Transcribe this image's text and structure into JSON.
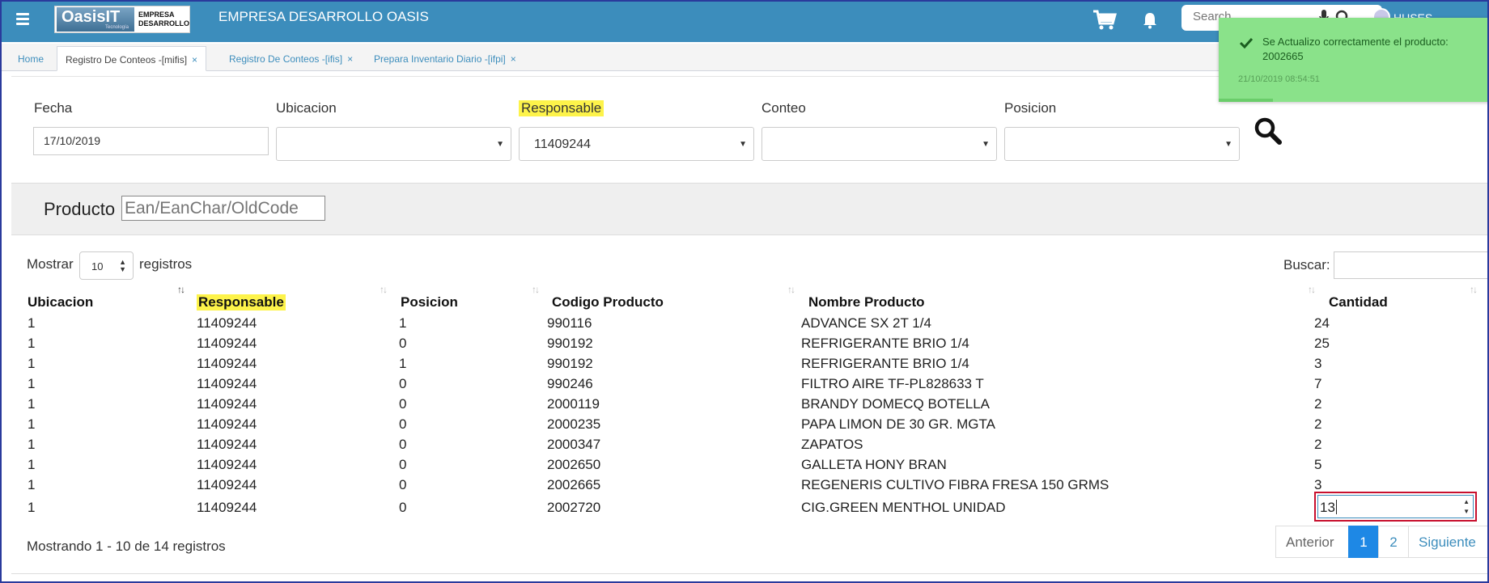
{
  "app": {
    "title": "EMPRESA DESARROLLO OASIS",
    "logo_brand": "OasisIT",
    "logo_sub": "Tecnología",
    "logo_text_1": "EMPRESA",
    "logo_text_2": "DESARROLLO",
    "search_placeholder": "Search",
    "user_name": "HUSES",
    "accent_color": "#3c8dbc"
  },
  "tabs": [
    {
      "label": "Home",
      "closable": false,
      "active": false
    },
    {
      "label": "Registro De Conteos -[mifis]",
      "closable": true,
      "active": true
    },
    {
      "label": "Registro De Conteos -[ifis]",
      "closable": true,
      "active": false
    },
    {
      "label": "Prepara Inventario Diario -[ifpi]",
      "closable": true,
      "active": false
    }
  ],
  "tab_close_glyph": "×",
  "filters": {
    "fecha_label": "Fecha",
    "fecha_value": "17/10/2019",
    "ubicacion_label": "Ubicacion",
    "ubicacion_value": "",
    "responsable_label": "Responsable",
    "responsable_value": "11409244",
    "conteo_label": "Conteo",
    "conteo_value": "",
    "posicion_label": "Posicion",
    "posicion_value": ""
  },
  "product": {
    "label": "Producto",
    "placeholder": "Ean/EanChar/OldCode"
  },
  "table": {
    "show_label": "Mostrar",
    "page_length": "10",
    "records_label": "registros",
    "search_label": "Buscar:",
    "columns": [
      "Ubicacion",
      "Responsable",
      "Posicion",
      "Codigo Producto",
      "Nombre Producto",
      "Cantidad"
    ],
    "rows": [
      {
        "ubicacion": "1",
        "responsable": "11409244",
        "posicion": "1",
        "codigo": "990116",
        "nombre": "ADVANCE SX 2T 1/4",
        "cantidad": "24"
      },
      {
        "ubicacion": "1",
        "responsable": "11409244",
        "posicion": "0",
        "codigo": "990192",
        "nombre": "REFRIGERANTE BRIO 1/4",
        "cantidad": "25"
      },
      {
        "ubicacion": "1",
        "responsable": "11409244",
        "posicion": "1",
        "codigo": "990192",
        "nombre": "REFRIGERANTE BRIO 1/4",
        "cantidad": "3"
      },
      {
        "ubicacion": "1",
        "responsable": "11409244",
        "posicion": "0",
        "codigo": "990246",
        "nombre": "FILTRO AIRE TF-PL828633 T",
        "cantidad": "7"
      },
      {
        "ubicacion": "1",
        "responsable": "11409244",
        "posicion": "0",
        "codigo": "2000119",
        "nombre": "BRANDY DOMECQ BOTELLA",
        "cantidad": "2"
      },
      {
        "ubicacion": "1",
        "responsable": "11409244",
        "posicion": "0",
        "codigo": "2000235",
        "nombre": "PAPA LIMON DE 30 GR. MGTA",
        "cantidad": "2"
      },
      {
        "ubicacion": "1",
        "responsable": "11409244",
        "posicion": "0",
        "codigo": "2000347",
        "nombre": "ZAPATOS",
        "cantidad": "2"
      },
      {
        "ubicacion": "1",
        "responsable": "11409244",
        "posicion": "0",
        "codigo": "2002650",
        "nombre": "GALLETA HONY BRAN",
        "cantidad": "5"
      },
      {
        "ubicacion": "1",
        "responsable": "11409244",
        "posicion": "0",
        "codigo": "2002665",
        "nombre": "REGENERIS CULTIVO FIBRA FRESA 150 GRMS",
        "cantidad": "3"
      },
      {
        "ubicacion": "1",
        "responsable": "11409244",
        "posicion": "0",
        "codigo": "2002720",
        "nombre": "CIG.GREEN MENTHOL UNIDAD",
        "cantidad": "13"
      }
    ],
    "info": "Mostrando 1 - 10 de 14 registros",
    "pager": {
      "prev": "Anterior",
      "page1": "1",
      "page2": "2",
      "next": "Siguiente"
    }
  },
  "toast": {
    "message": "Se Actualizo correctamente el producto: 2002665",
    "time": "21/10/2019 08:54:51",
    "progress": 0.2,
    "color": "#8ae28a"
  }
}
